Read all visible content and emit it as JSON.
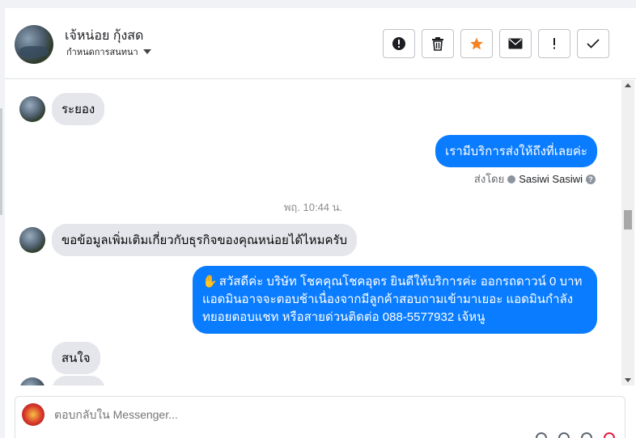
{
  "contact": {
    "name": "เจ้หน่อย กุ้งสด",
    "assign_label": "กำหนดการสนทนา"
  },
  "toolbar": {
    "buttons": [
      {
        "icon": "alert-circle-icon"
      },
      {
        "icon": "trash-icon"
      },
      {
        "icon": "star-icon",
        "color": "#f58220"
      },
      {
        "icon": "mail-icon"
      },
      {
        "icon": "exclamation-icon"
      },
      {
        "icon": "check-icon"
      }
    ]
  },
  "messages": [
    {
      "dir": "in",
      "text": "ระยอง"
    },
    {
      "dir": "out",
      "text": "เรามีบริการส่งให้ถึงที่เลยค่ะ"
    },
    {
      "dir": "meta",
      "sent_by_label": "ส่งโดย",
      "sent_by_name": "Sasiwi Sasiwi"
    },
    {
      "dir": "time",
      "text": "พฤ. 10:44 น."
    },
    {
      "dir": "in",
      "text": "ขอข้อมูลเพิ่มเติมเกี่ยวกับธุรกิจของคุณหน่อยได้ไหมครับ"
    },
    {
      "dir": "out",
      "hand": "✋",
      "text": "สวัสดีค่ะ บริษัท โชคคุณโชคอุดร ยินดีให้บริการค่ะ ออกรถดาวน์ 0 บาท แอดมินอาจจะตอบช้าเนื่องจากมีลูกค้าสอบถามเข้ามาเยอะ แอดมินกำลังทยอยตอบแชท หรือสายด่วนติดต่อ 088-5577932 เจ้หนู"
    },
    {
      "dir": "in",
      "text": "สนใจ"
    }
  ],
  "composer": {
    "placeholder": "ตอบกลับใน Messenger..."
  },
  "colors": {
    "outgoing": "#0a7cff",
    "incoming": "#e4e6eb",
    "accent_star": "#f58220"
  }
}
